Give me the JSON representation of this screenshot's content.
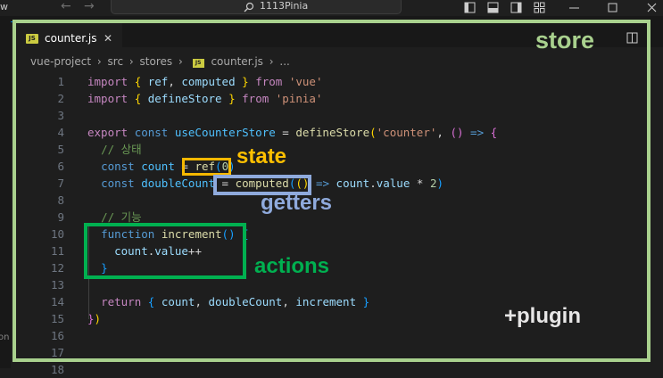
{
  "titlebar": {
    "left_label": "w",
    "search_text": "1113Pinia",
    "back_icon": "arrow-left-icon",
    "forward_icon": "arrow-right-icon",
    "search_icon": "search-icon",
    "layout_icons": [
      "panel-left-icon",
      "panel-bottom-icon",
      "panel-right-icon",
      "customize-layout-icon"
    ],
    "window_controls": [
      "minimize-icon",
      "maximize-icon",
      "close-icon"
    ]
  },
  "tab": {
    "file_badge": "JS",
    "label": "counter.js",
    "close_glyph": "✕"
  },
  "breadcrumb": {
    "items": [
      "vue-project",
      "src",
      "stores",
      "counter.js",
      "..."
    ],
    "file_badge": "JS"
  },
  "split_icon": "split-editor-icon",
  "editor": {
    "line_numbers": [
      "1",
      "2",
      "3",
      "4",
      "5",
      "6",
      "7",
      "8",
      "9",
      "10",
      "11",
      "12",
      "13",
      "14",
      "15",
      "16",
      "17",
      "18"
    ],
    "side_fragment": "on"
  },
  "annotations": {
    "store": "store",
    "state": "state",
    "getters": "getters",
    "actions": "actions",
    "plugin": "+plugin"
  },
  "colors": {
    "store_frame": "#a9d18e",
    "state_box": "#f5b800",
    "getters_box": "#8faadc",
    "actions_box": "#00b050",
    "store_text": "#a9d18e",
    "state_text": "#ffc000",
    "getters_text": "#8faadc",
    "actions_text": "#00b050",
    "plugin_text": "#e7e6e6"
  }
}
